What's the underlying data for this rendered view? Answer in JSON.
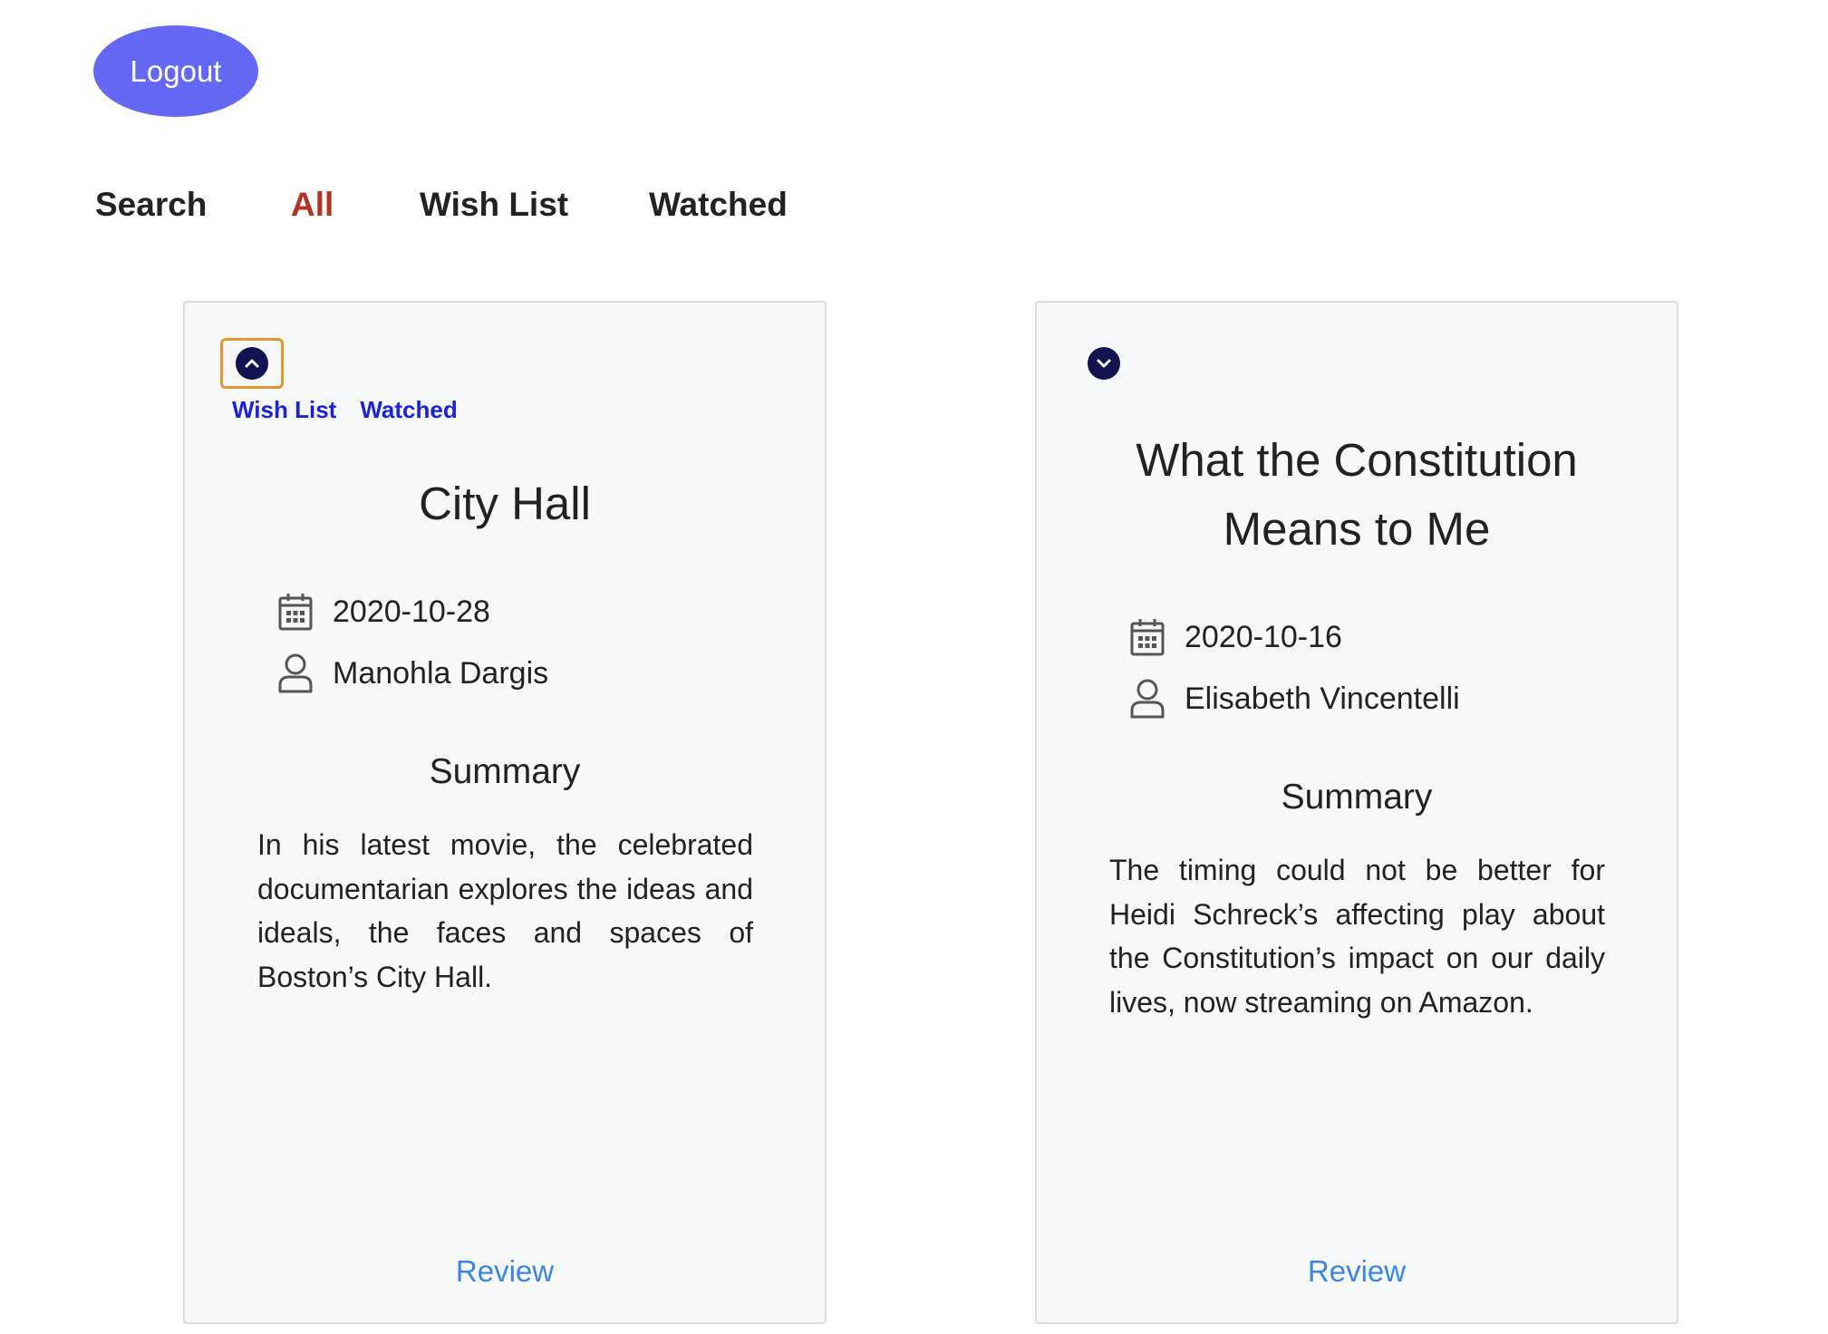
{
  "header": {
    "logout_label": "Logout"
  },
  "nav": {
    "items": [
      {
        "label": "Search",
        "active": false
      },
      {
        "label": "All",
        "active": true
      },
      {
        "label": "Wish List",
        "active": false
      },
      {
        "label": "Watched",
        "active": false
      }
    ]
  },
  "cards": [
    {
      "expanded": true,
      "toggle_icon": "chevron-up-icon",
      "actions": [
        "Wish List",
        "Watched"
      ],
      "title": "City Hall",
      "date": "2020-10-28",
      "date_icon": "calendar-icon",
      "author": "Manohla Dargis",
      "author_icon": "user-icon",
      "summary_heading": "Summary",
      "summary": "In his latest movie, the celebrated documentarian explores the ideas and ideals, the faces and spaces of Boston’s City Hall.",
      "review_label": "Review"
    },
    {
      "expanded": false,
      "toggle_icon": "chevron-down-icon",
      "title": "What the Constitution Means to Me",
      "date": "2020-10-16",
      "date_icon": "calendar-icon",
      "author": "Elisabeth Vincentelli",
      "author_icon": "user-icon",
      "summary_heading": "Summary",
      "summary": "The timing could not be better for Heidi Schreck’s affecting play about the Constitution’s impact on our daily lives, now streaming on Amazon.",
      "review_label": "Review"
    }
  ],
  "colors": {
    "logout_bg": "#6568f5",
    "nav_active": "#b33423",
    "card_bg": "#f7f8fa",
    "toggle_bg": "#121451",
    "focus_ring": "#e3962b",
    "list_link": "#1a22dc",
    "review_link": "#3b86e0"
  }
}
